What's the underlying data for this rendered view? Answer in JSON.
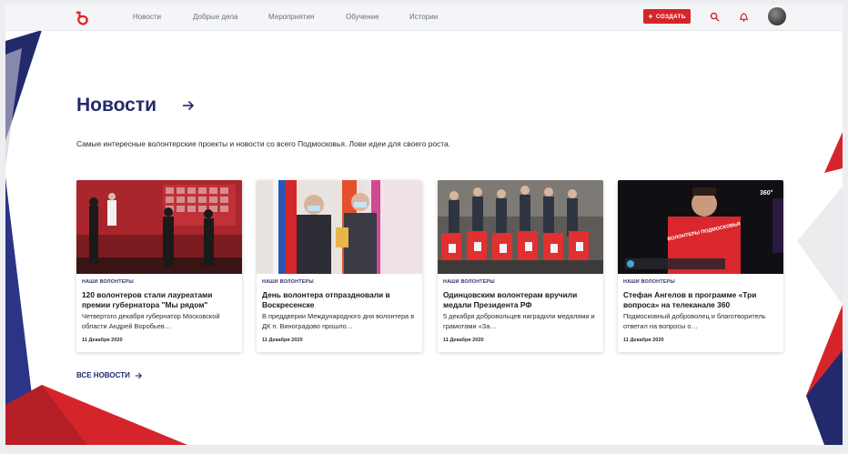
{
  "nav": {
    "items": [
      "Новости",
      "Добрые дела",
      "Мероприятия",
      "Обучение",
      "Истории"
    ],
    "create_label": "СОЗДАТЬ",
    "brand_color": "#d5252b"
  },
  "section": {
    "title": "Новости",
    "subtitle": "Самые интересные волонтерские проекты и новости со всего Подмосковья. Лови идеи для своего роста.",
    "all_news_label": "ВСЕ НОВОСТИ"
  },
  "cards": [
    {
      "tag": "НАШИ ВОЛОНТЕРЫ",
      "title": "120 волонтеров стали лауреатами премии губернатора \"Мы рядом\"",
      "desc": "Четвертого декабря губернатор Московской области Андрей Воробьев…",
      "date": "11 Декабря 2020"
    },
    {
      "tag": "НАШИ ВОЛОНТЕРЫ",
      "title": "День волонтера отпраздновали в Воскресенске",
      "desc": "В преддверии Международного дня волонтера в ДК п. Виноградово прошло…",
      "date": "11 Декабря 2020"
    },
    {
      "tag": "НАШИ ВОЛОНТЕРЫ",
      "title": "Одинцовским волонтерам вручили медали Президента РФ",
      "desc": "5 декабря добровольцев наградили медалями и грамотами «За…",
      "date": "11 Декабря 2020"
    },
    {
      "tag": "НАШИ ВОЛОНТЕРЫ",
      "title": "Стефан Ангелов в программе «Три вопроса» на телеканале 360",
      "desc": "Подмосковный доброволец и благотворитель ответил на вопросы о…",
      "date": "11 Декабря 2020",
      "tv_logo": "360°",
      "shirt_text": "ВОЛОНТЕРЫ ПОДМОСКОВЬЯ"
    }
  ]
}
